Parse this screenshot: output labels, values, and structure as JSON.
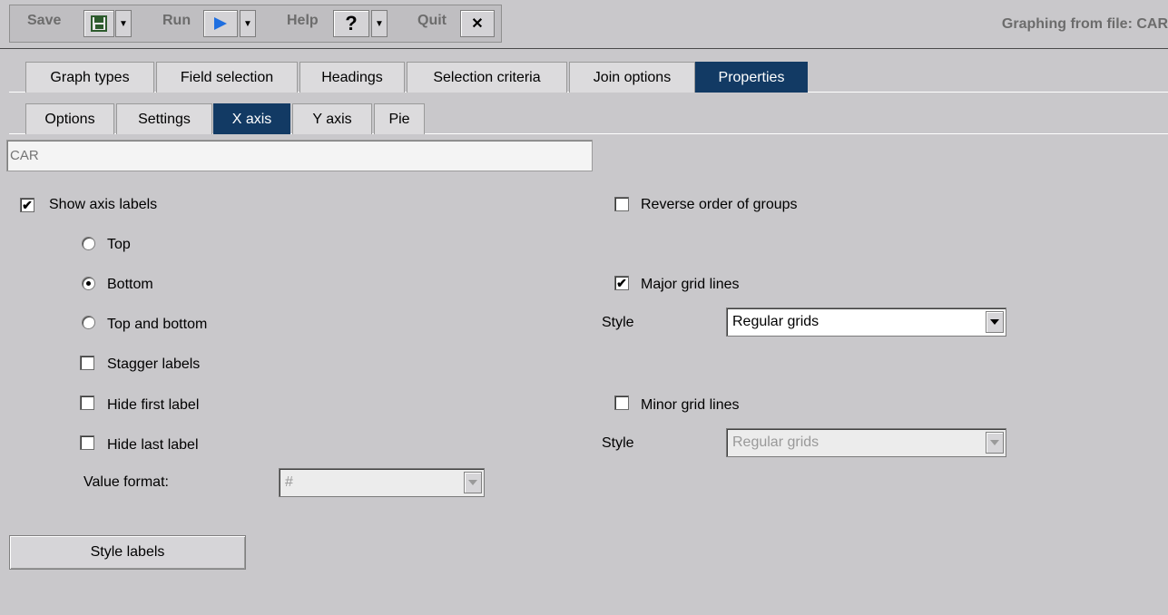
{
  "toolbar": {
    "save_label": "Save",
    "run_label": "Run",
    "help_label": "Help",
    "help_glyph": "?",
    "quit_label": "Quit",
    "quit_glyph": "✕",
    "title": "Graphing from file: CAR"
  },
  "tabs_main": [
    {
      "label": "Graph types",
      "active": false
    },
    {
      "label": "Field selection",
      "active": false
    },
    {
      "label": "Headings",
      "active": false
    },
    {
      "label": "Selection criteria",
      "active": false
    },
    {
      "label": "Join options",
      "active": false
    },
    {
      "label": "Properties",
      "active": true
    }
  ],
  "tabs_sub": [
    {
      "label": "Options",
      "active": false
    },
    {
      "label": "Settings",
      "active": false
    },
    {
      "label": "X axis",
      "active": true
    },
    {
      "label": "Y axis",
      "active": false
    },
    {
      "label": "Pie",
      "active": false
    }
  ],
  "axis_title": {
    "placeholder": "CAR",
    "value": ""
  },
  "left": {
    "show_axis_labels": {
      "label": "Show axis labels",
      "checked": true
    },
    "position_options": [
      {
        "label": "Top",
        "selected": false
      },
      {
        "label": "Bottom",
        "selected": true
      },
      {
        "label": "Top and bottom",
        "selected": false
      }
    ],
    "stagger_labels": {
      "label": "Stagger labels",
      "checked": false
    },
    "hide_first_label": {
      "label": "Hide first label",
      "checked": false
    },
    "hide_last_label": {
      "label": "Hide last label",
      "checked": false
    },
    "value_format": {
      "label": "Value format:",
      "value": "#"
    }
  },
  "right": {
    "reverse_order": {
      "label": "Reverse order of groups",
      "checked": false
    },
    "major_grid": {
      "label": "Major grid lines",
      "checked": true
    },
    "major_style": {
      "label": "Style",
      "value": "Regular grids"
    },
    "minor_grid": {
      "label": "Minor grid lines",
      "checked": false
    },
    "minor_style": {
      "label": "Style",
      "value": "Regular grids"
    }
  },
  "style_labels_button": "Style labels",
  "colors": {
    "active_tab": "#123a64",
    "background": "#c9c8cb",
    "run_icon": "#1f6fe0"
  }
}
